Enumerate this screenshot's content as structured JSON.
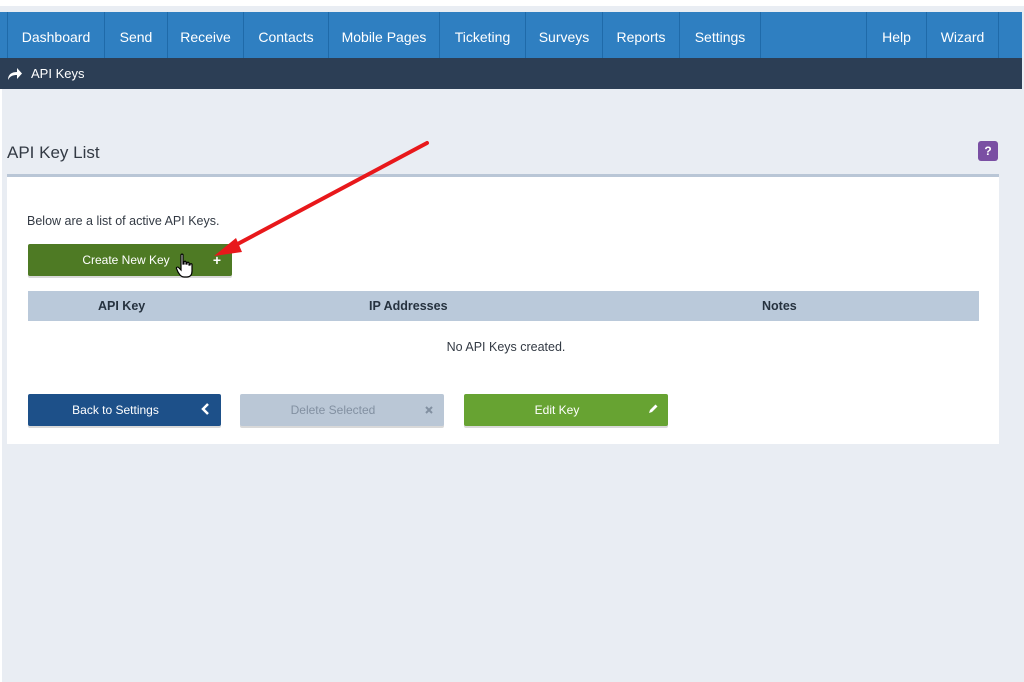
{
  "nav": {
    "items": [
      {
        "label": "Dashboard"
      },
      {
        "label": "Send"
      },
      {
        "label": "Receive"
      },
      {
        "label": "Contacts"
      },
      {
        "label": "Mobile Pages"
      },
      {
        "label": "Ticketing"
      },
      {
        "label": "Surveys"
      },
      {
        "label": "Reports"
      },
      {
        "label": "Settings"
      }
    ],
    "right_items": [
      {
        "label": "Help"
      },
      {
        "label": "Wizard"
      }
    ]
  },
  "breadcrumb": {
    "icon": "share-arrow-icon",
    "label": "API Keys"
  },
  "page": {
    "title": "API Key List",
    "help_label": "?",
    "intro": "Below are a list of active API Keys."
  },
  "buttons": {
    "create_label": "Create New Key",
    "create_icon": "plus-icon",
    "back_label": "Back to Settings",
    "back_icon": "chevron-left-icon",
    "delete_label": "Delete Selected",
    "delete_icon": "close-icon",
    "edit_label": "Edit Key",
    "edit_icon": "pencil-icon"
  },
  "table": {
    "columns": [
      "API Key",
      "IP Addresses",
      "Notes"
    ],
    "empty_message": "No API Keys created."
  },
  "colors": {
    "nav_bg": "#2f7fc1",
    "crumb_bg": "#2c3e55",
    "create_bg": "#4e7a24",
    "back_bg": "#1d5089",
    "delete_bg": "#bac7d6",
    "edit_bg": "#67a332",
    "annotation_arrow": "#e8181b"
  }
}
